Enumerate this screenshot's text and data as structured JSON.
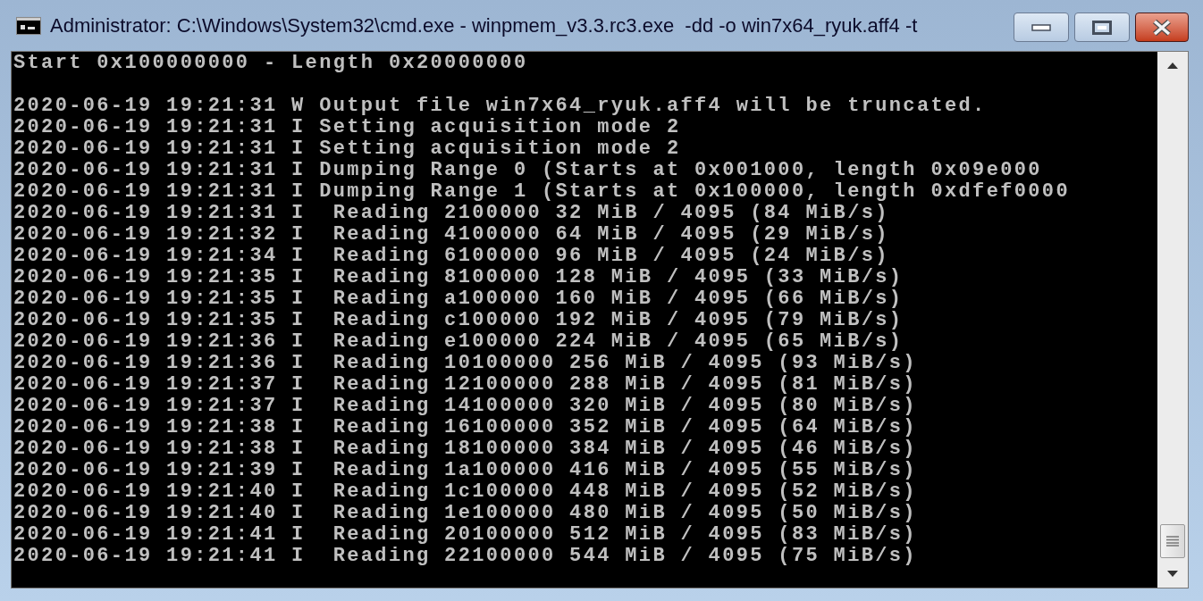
{
  "window": {
    "title": "Administrator: C:\\Windows\\System32\\cmd.exe - winpmem_v3.3.rc3.exe  -dd -o win7x64_ryuk.aff4 -t"
  },
  "console": {
    "header": "Start 0x100000000 - Length 0x20000000",
    "log": [
      "2020-06-19 19:21:31 W Output file win7x64_ryuk.aff4 will be truncated.",
      "2020-06-19 19:21:31 I Setting acquisition mode 2",
      "2020-06-19 19:21:31 I Setting acquisition mode 2",
      "2020-06-19 19:21:31 I Dumping Range 0 (Starts at 0x001000, length 0x09e000",
      "2020-06-19 19:21:31 I Dumping Range 1 (Starts at 0x100000, length 0xdfef0000",
      "2020-06-19 19:21:31 I  Reading 2100000 32 MiB / 4095 (84 MiB/s)",
      "2020-06-19 19:21:32 I  Reading 4100000 64 MiB / 4095 (29 MiB/s)",
      "2020-06-19 19:21:34 I  Reading 6100000 96 MiB / 4095 (24 MiB/s)",
      "2020-06-19 19:21:35 I  Reading 8100000 128 MiB / 4095 (33 MiB/s)",
      "2020-06-19 19:21:35 I  Reading a100000 160 MiB / 4095 (66 MiB/s)",
      "2020-06-19 19:21:35 I  Reading c100000 192 MiB / 4095 (79 MiB/s)",
      "2020-06-19 19:21:36 I  Reading e100000 224 MiB / 4095 (65 MiB/s)",
      "2020-06-19 19:21:36 I  Reading 10100000 256 MiB / 4095 (93 MiB/s)",
      "2020-06-19 19:21:37 I  Reading 12100000 288 MiB / 4095 (81 MiB/s)",
      "2020-06-19 19:21:37 I  Reading 14100000 320 MiB / 4095 (80 MiB/s)",
      "2020-06-19 19:21:38 I  Reading 16100000 352 MiB / 4095 (64 MiB/s)",
      "2020-06-19 19:21:38 I  Reading 18100000 384 MiB / 4095 (46 MiB/s)",
      "2020-06-19 19:21:39 I  Reading 1a100000 416 MiB / 4095 (55 MiB/s)",
      "2020-06-19 19:21:40 I  Reading 1c100000 448 MiB / 4095 (52 MiB/s)",
      "2020-06-19 19:21:40 I  Reading 1e100000 480 MiB / 4095 (50 MiB/s)",
      "2020-06-19 19:21:41 I  Reading 20100000 512 MiB / 4095 (83 MiB/s)",
      "2020-06-19 19:21:41 I  Reading 22100000 544 MiB / 4095 (75 MiB/s)"
    ]
  }
}
